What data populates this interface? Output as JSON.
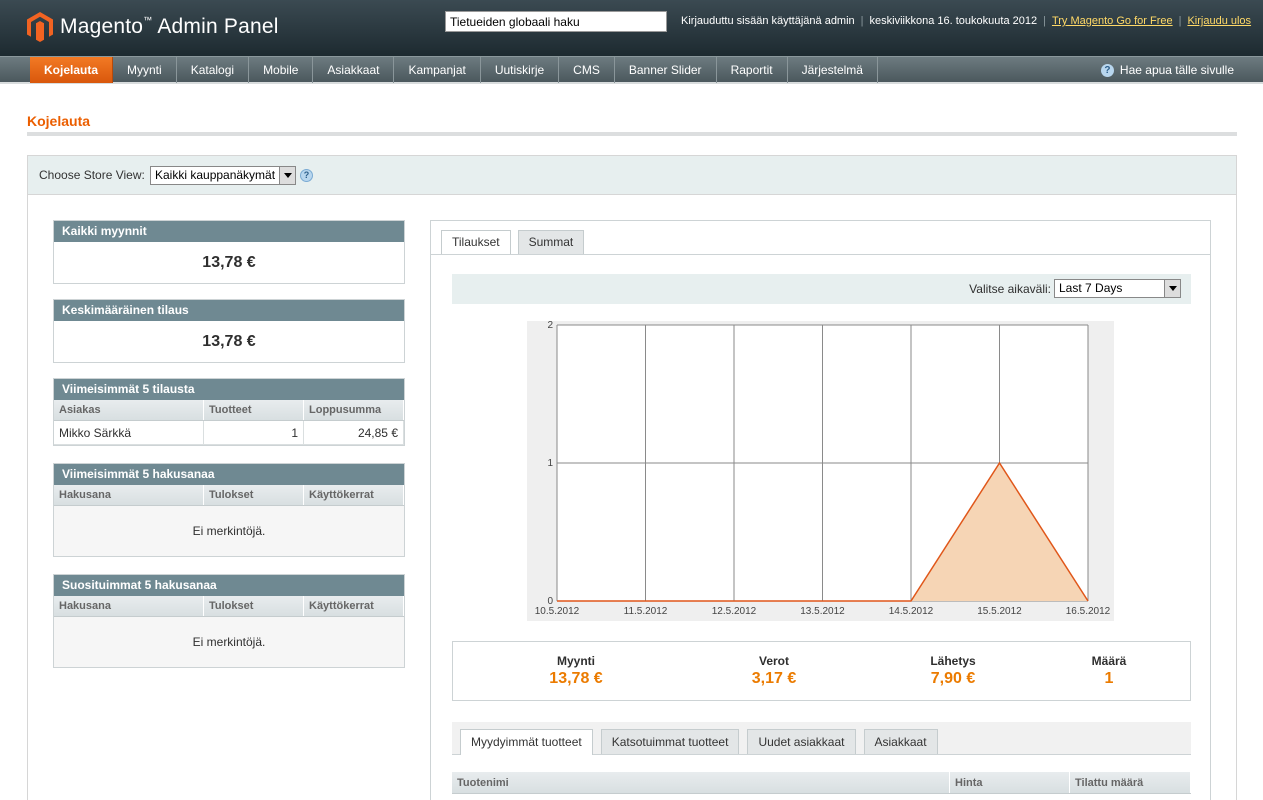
{
  "header": {
    "logo_brand": "Magento",
    "logo_sub": "Admin Panel",
    "search_value": "Tietueiden globaali haku",
    "logged_in": "Kirjauduttu sisään käyttäjänä admin",
    "date": "keskiviikkona 16. toukokuuta 2012",
    "try_link": "Try Magento Go for Free",
    "logout_link": "Kirjaudu ulos"
  },
  "nav": {
    "items": [
      "Kojelauta",
      "Myynti",
      "Katalogi",
      "Mobile",
      "Asiakkaat",
      "Kampanjat",
      "Uutiskirje",
      "CMS",
      "Banner Slider",
      "Raportit",
      "Järjestelmä"
    ],
    "active": "Kojelauta",
    "help": "Hae apua tälle sivulle"
  },
  "page": {
    "title": "Kojelauta",
    "store_view_label": "Choose Store View:",
    "store_view_value": "Kaikki kauppanäkymät"
  },
  "boxes": {
    "all_sales": {
      "title": "Kaikki myynnit",
      "value": "13,78 €"
    },
    "avg_order": {
      "title": "Keskimääräinen tilaus",
      "value": "13,78 €"
    },
    "last_orders": {
      "title": "Viimeisimmät 5 tilausta",
      "columns": [
        "Asiakas",
        "Tuotteet",
        "Loppusumma"
      ],
      "rows": [
        [
          "Mikko Särkkä",
          "1",
          "24,85 €"
        ]
      ]
    },
    "last_search": {
      "title": "Viimeisimmät 5 hakusanaa",
      "columns": [
        "Hakusana",
        "Tulokset",
        "Käyttökerrat"
      ],
      "empty": "Ei merkintöjä."
    },
    "top_search": {
      "title": "Suosituimmat 5 hakusanaa",
      "columns": [
        "Hakusana",
        "Tulokset",
        "Käyttökerrat"
      ],
      "empty": "Ei merkintöjä."
    }
  },
  "chart_panel": {
    "tabs": [
      "Tilaukset",
      "Summat"
    ],
    "active_tab": "Tilaukset",
    "range_label": "Valitse aikaväli:",
    "range_value": "Last 7 Days"
  },
  "chart_data": {
    "type": "area",
    "x": [
      "10.5.2012",
      "11.5.2012",
      "12.5.2012",
      "13.5.2012",
      "14.5.2012",
      "15.5.2012",
      "16.5.2012"
    ],
    "series": [
      {
        "values": [
          0,
          0,
          0,
          0,
          0,
          1,
          0
        ],
        "color": "#f6d5b5",
        "stroke": "#e0571a"
      }
    ],
    "ylim": [
      0,
      2
    ],
    "yticks": [
      "0",
      "1",
      "2"
    ],
    "grid": true
  },
  "totals": [
    {
      "label": "Myynti",
      "value": "13,78 €"
    },
    {
      "label": "Verot",
      "value": "3,17 €"
    },
    {
      "label": "Lähetys",
      "value": "7,90 €"
    },
    {
      "label": "Määrä",
      "value": "1"
    }
  ],
  "bottom_tabs": [
    "Myydyimmät tuotteet",
    "Katsotuimmat tuotteet",
    "Uudet asiakkaat",
    "Asiakkaat"
  ],
  "product_grid_columns": [
    "Tuotenimi",
    "Hinta",
    "Tilattu määrä"
  ],
  "colors": {
    "accent": "#eb5e00",
    "nav_active": "#f27a24",
    "box_head": "#6f8992",
    "link": "#ffd967"
  }
}
